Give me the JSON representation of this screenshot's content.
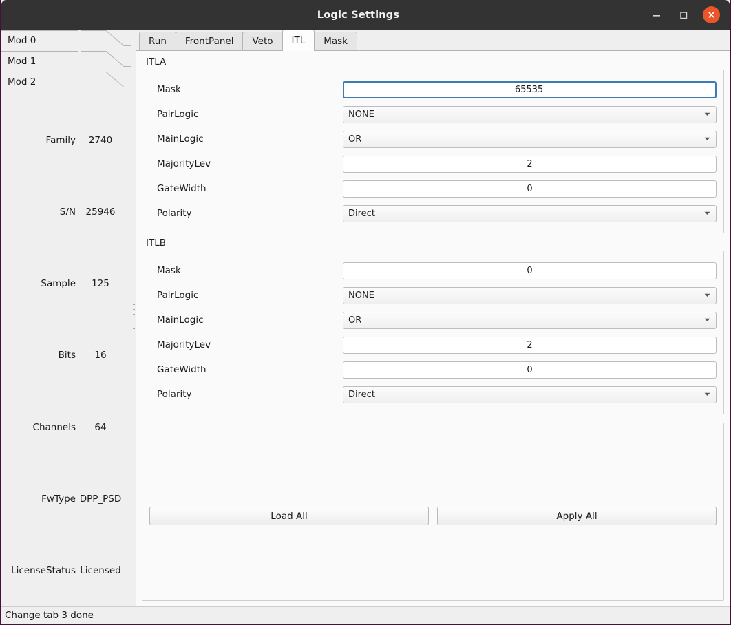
{
  "window": {
    "title": "Logic Settings",
    "controls": {
      "minimize": "minimize-icon",
      "maximize": "maximize-icon",
      "close": "close-icon"
    },
    "accent_close": "#e8562a",
    "titlebar_bg": "#333333",
    "border_color": "#4a1138"
  },
  "sidebar": {
    "module_tabs": [
      {
        "label": "Mod 0",
        "selected": false
      },
      {
        "label": "Mod 1",
        "selected": false
      },
      {
        "label": "Mod 2",
        "selected": true
      }
    ],
    "info": [
      {
        "label": "Family",
        "value": "2740"
      },
      {
        "label": "S/N",
        "value": "25946"
      },
      {
        "label": "Sample",
        "value": "125"
      },
      {
        "label": "Bits",
        "value": "16"
      },
      {
        "label": "Channels",
        "value": "64"
      },
      {
        "label": "FwType",
        "value": "DPP_PSD"
      },
      {
        "label": "LicenseStatus",
        "value": "Licensed"
      }
    ]
  },
  "tabs": [
    {
      "label": "Run",
      "active": false
    },
    {
      "label": "FrontPanel",
      "active": false
    },
    {
      "label": "Veto",
      "active": false
    },
    {
      "label": "ITL",
      "active": true
    },
    {
      "label": "Mask",
      "active": false
    }
  ],
  "groups": [
    {
      "title": "ITLA",
      "fields": [
        {
          "label": "Mask",
          "type": "lineedit",
          "value": "65535",
          "focused": true
        },
        {
          "label": "PairLogic",
          "type": "combo",
          "value": "NONE"
        },
        {
          "label": "MainLogic",
          "type": "combo",
          "value": "OR"
        },
        {
          "label": "MajorityLev",
          "type": "lineedit",
          "value": "2",
          "focused": false
        },
        {
          "label": "GateWidth",
          "type": "lineedit",
          "value": "0",
          "focused": false
        },
        {
          "label": "Polarity",
          "type": "combo",
          "value": "Direct"
        }
      ]
    },
    {
      "title": "ITLB",
      "fields": [
        {
          "label": "Mask",
          "type": "lineedit",
          "value": "0",
          "focused": false
        },
        {
          "label": "PairLogic",
          "type": "combo",
          "value": "NONE"
        },
        {
          "label": "MainLogic",
          "type": "combo",
          "value": "OR"
        },
        {
          "label": "MajorityLev",
          "type": "lineedit",
          "value": "2",
          "focused": false
        },
        {
          "label": "GateWidth",
          "type": "lineedit",
          "value": "0",
          "focused": false
        },
        {
          "label": "Polarity",
          "type": "combo",
          "value": "Direct"
        }
      ]
    }
  ],
  "actions": {
    "load_all": "Load All",
    "apply_all": "Apply All"
  },
  "statusbar": {
    "message": "Change tab 3 done"
  }
}
